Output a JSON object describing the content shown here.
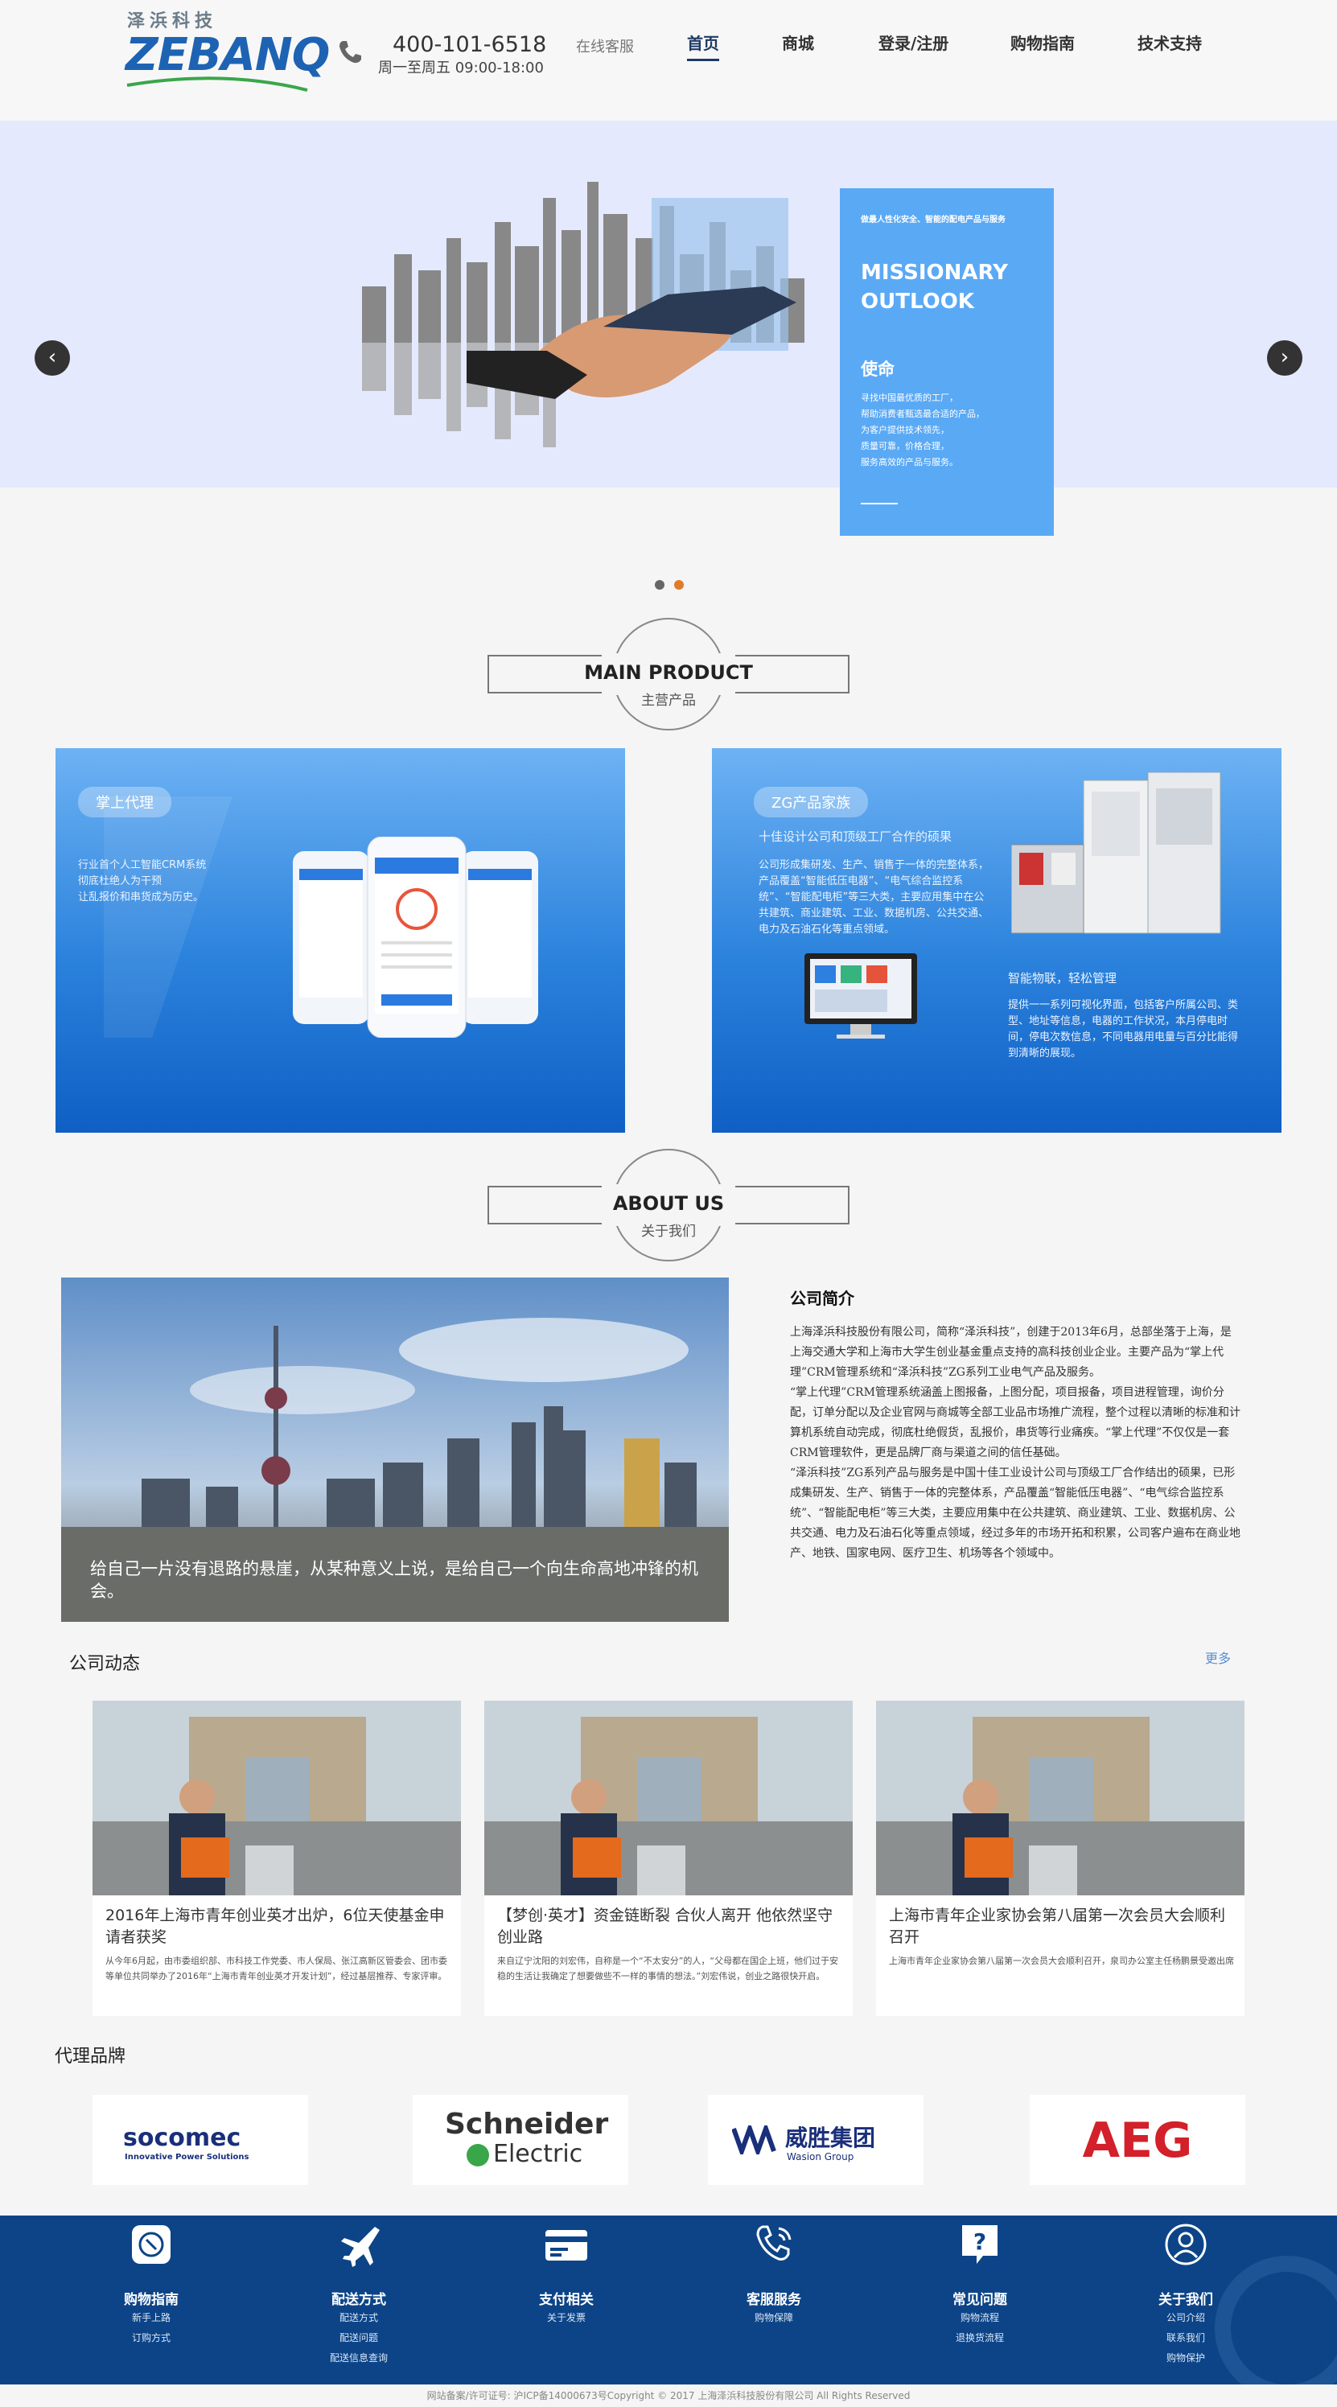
{
  "header": {
    "logo_cn": "泽浜科技",
    "logo_en": "ZEBANQ",
    "phone": "400-101-6518",
    "hours": "周一至周五 09:00-18:00",
    "online_service": "在线客服",
    "nav": [
      "首页",
      "商城",
      "登录/注册",
      "购物指南",
      "技术支持"
    ]
  },
  "hero": {
    "tagline": "做最人性化安全、智能的配电产品与服务",
    "title_line1": "MISSIONARY",
    "title_line2": "OUTLOOK",
    "heading": "使命",
    "lines": [
      "寻找中国最优质的工厂，",
      "帮助消费者甄选最合适的产品，",
      "为客户提供技术领先，",
      "质量可靠，价格合理，",
      "服务高效的产品与服务。"
    ],
    "prev": "‹",
    "next": "›"
  },
  "main_product": {
    "en": "MAIN PRODUCT",
    "cn": "主营产品"
  },
  "products": [
    {
      "badge": "掌上代理",
      "lines": [
        "行业首个人工智能CRM系统",
        "彻底杜绝人为干预",
        "让乱报价和串货成为历史。"
      ]
    },
    {
      "badge": "ZG产品家族",
      "subtitle": "十佳设计公司和顶级工厂合作的硕果",
      "text": "公司形成集研发、生产、销售于一体的完整体系，产品覆盖“智能低压电器”、“电气综合监控系统”、“智能配电柜”等三大类，主要应用集中在公共建筑、商业建筑、工业、数据机房、公共交通、电力及石油石化等重点领域。",
      "sub2": "智能物联，轻松管理",
      "text2": "提供一一系列可视化界面，包括客户所属公司、类型、地址等信息，电器的工作状况，本月停电时间，停电次数信息，不同电器用电量与百分比能得到清晰的展现。"
    }
  ],
  "about": {
    "en": "ABOUT US",
    "cn": "关于我们",
    "caption": "给自己一片没有退路的悬崖，从某种意义上说，是给自己一个向生命高地冲锋的机会。",
    "intro_title": "公司简介",
    "paragraphs": [
      "上海泽浜科技股份有限公司，简称“泽浜科技”，创建于2013年6月，总部坐落于上海，是上海交通大学和上海市大学生创业基金重点支持的高科技创业企业。主要产品为“掌上代理”CRM管理系统和“泽浜科技”ZG系列工业电气产品及服务。",
      "“掌上代理”CRM管理系统涵盖上图报备，上图分配，项目报备，项目进程管理，询价分配，订单分配以及企业官网与商城等全部工业品市场推广流程，整个过程以清晰的标准和计算机系统自动完成，彻底杜绝假货，乱报价，串货等行业痛疾。“掌上代理”不仅仅是一套CRM管理软件，更是品牌厂商与渠道之间的信任基础。",
      "“泽浜科技”ZG系列产品与服务是中国十佳工业设计公司与顶级工厂合作结出的硕果，已形成集研发、生产、销售于一体的完整体系，产品覆盖“智能低压电器”、“电气综合监控系统”、“智能配电柜”等三大类，主要应用集中在公共建筑、商业建筑、工业、数据机房、公共交通、电力及石油石化等重点领域，经过多年的市场开拓和积累，公司客户遍布在商业地产、地铁、国家电网、医疗卫生、机场等各个领域中。"
    ]
  },
  "news": {
    "title": "公司动态",
    "more": "更多",
    "items": [
      {
        "title": "2016年上海市青年创业英才出炉，6位天使基金申请者获奖",
        "desc": "从今年6月起，由市委组织部、市科技工作党委、市人保局、张江高新区管委会、团市委等单位共同举办了2016年“上海市青年创业英才开发计划”，经过基层推荐、专家评审。"
      },
      {
        "title": "【梦创·英才】资金链断裂 合伙人离开 他依然坚守创业路",
        "desc": "来自辽宁沈阳的刘宏伟，自称是一个“不太安分”的人，“父母都在国企上班，他们过于安稳的生活让我确定了想要做些不一样的事情的想法。”刘宏伟说，创业之路很快开启。"
      },
      {
        "title": "上海市青年企业家协会第八届第一次会员大会顺利召开",
        "desc": "上海市青年企业家协会第八届第一次会员大会顺利召开，泉司办公室主任杨鹏景受邀出席"
      }
    ]
  },
  "brands": {
    "title": "代理品牌",
    "items": [
      "socomec",
      "Innovative Power Solutions",
      "Schneider",
      "Electric",
      "威胜集团",
      "Wasion Group",
      "AEG"
    ]
  },
  "footer": {
    "cols": [
      {
        "h": "购物指南",
        "links": [
          "新手上路",
          "订购方式"
        ]
      },
      {
        "h": "配送方式",
        "links": [
          "配送方式",
          "配送问题",
          "配送信息查询"
        ]
      },
      {
        "h": "支付相关",
        "links": [
          "关于发票"
        ]
      },
      {
        "h": "客服服务",
        "links": [
          "购物保障"
        ]
      },
      {
        "h": "常见问题",
        "links": [
          "购物流程",
          "退换货流程"
        ]
      },
      {
        "h": "关于我们",
        "links": [
          "公司介绍",
          "联系我们",
          "购物保护"
        ]
      }
    ],
    "copyright": "网站备案/许可证号: 沪ICP备14000673号Copyright © 2017 上海泽浜科技股份有限公司 All Rights Reserved"
  },
  "colors": {
    "primary": "#0c4487",
    "accent": "#5aa9f5",
    "dot_active": "#e07b2a"
  }
}
